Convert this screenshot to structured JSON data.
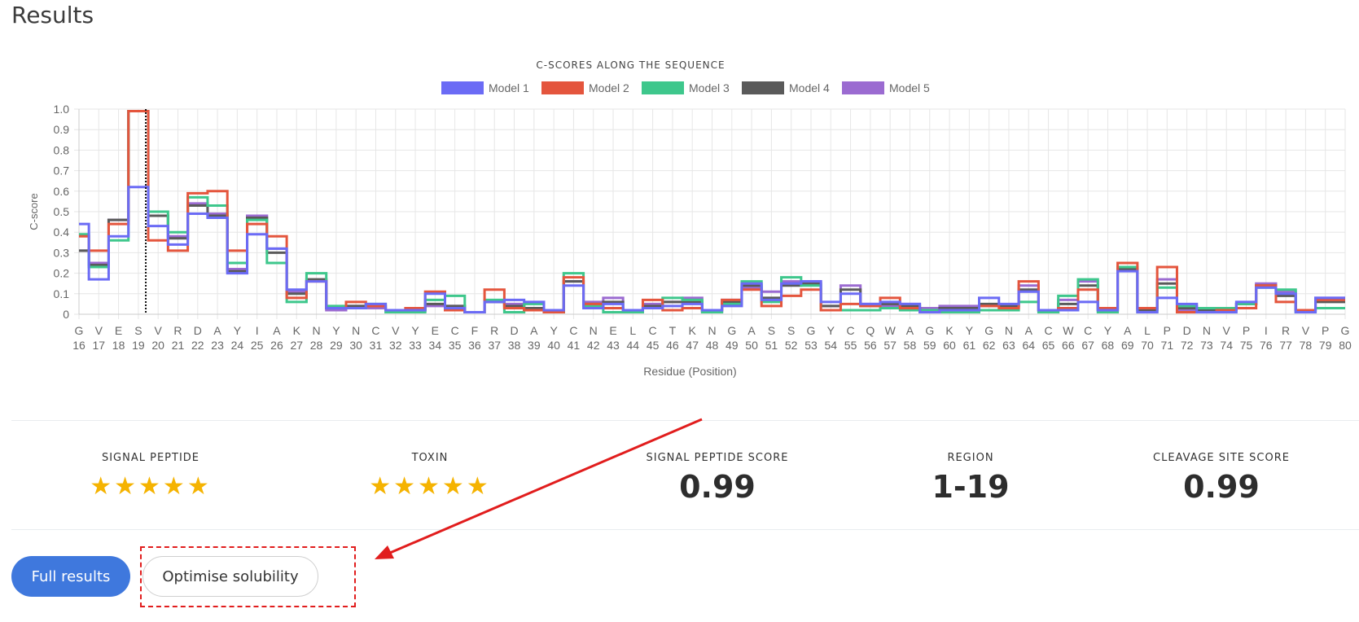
{
  "page": {
    "title": "Results"
  },
  "chart_data": {
    "type": "line",
    "title": "C-SCORES ALONG THE SEQUENCE",
    "xlabel": "Residue (Position)",
    "ylabel": "C-score",
    "ylim": [
      0,
      1.0
    ],
    "yticks": [
      "1.0",
      "0.9",
      "0.8",
      "0.7",
      "0.6",
      "0.5",
      "0.4",
      "0.3",
      "0.2",
      "0.1",
      "0"
    ],
    "grid": true,
    "legend_position": "top-center",
    "step": true,
    "highlight_position": 19,
    "residues": [
      "G",
      "V",
      "E",
      "S",
      "V",
      "R",
      "D",
      "A",
      "Y",
      "I",
      "A",
      "K",
      "N",
      "Y",
      "N",
      "C",
      "V",
      "Y",
      "E",
      "C",
      "F",
      "R",
      "D",
      "A",
      "Y",
      "C",
      "N",
      "E",
      "L",
      "C",
      "T",
      "K",
      "N",
      "G",
      "A",
      "S",
      "S",
      "G",
      "Y",
      "C",
      "Q",
      "W",
      "A",
      "G",
      "K",
      "Y",
      "G",
      "N",
      "A",
      "C",
      "W",
      "C",
      "Y",
      "A",
      "L",
      "P",
      "D",
      "N",
      "V",
      "P",
      "I",
      "R",
      "V",
      "P",
      "G"
    ],
    "positions": [
      "16",
      "17",
      "18",
      "19",
      "20",
      "21",
      "22",
      "23",
      "24",
      "25",
      "26",
      "27",
      "28",
      "29",
      "30",
      "31",
      "32",
      "33",
      "34",
      "35",
      "36",
      "37",
      "38",
      "39",
      "40",
      "41",
      "42",
      "43",
      "44",
      "45",
      "46",
      "47",
      "48",
      "49",
      "50",
      "51",
      "52",
      "53",
      "54",
      "55",
      "56",
      "57",
      "58",
      "59",
      "60",
      "61",
      "62",
      "63",
      "64",
      "65",
      "66",
      "67",
      "68",
      "69",
      "70",
      "71",
      "72",
      "73",
      "74",
      "75",
      "76",
      "77",
      "78",
      "79",
      "80"
    ],
    "series": [
      {
        "name": "Model 1",
        "color": "#6b6bf5",
        "values": [
          0.44,
          0.17,
          0.38,
          0.62,
          0.43,
          0.34,
          0.49,
          0.47,
          0.2,
          0.39,
          0.32,
          0.12,
          0.16,
          0.03,
          0.03,
          0.05,
          0.02,
          0.02,
          0.1,
          0.03,
          0.01,
          0.06,
          0.07,
          0.06,
          0.02,
          0.14,
          0.03,
          0.05,
          0.02,
          0.03,
          0.04,
          0.05,
          0.02,
          0.04,
          0.15,
          0.07,
          0.15,
          0.16,
          0.06,
          0.1,
          0.05,
          0.06,
          0.05,
          0.01,
          0.02,
          0.02,
          0.08,
          0.05,
          0.11,
          0.02,
          0.02,
          0.06,
          0.02,
          0.21,
          0.01,
          0.08,
          0.05,
          0.01,
          0.01,
          0.06,
          0.13,
          0.1,
          0.01,
          0.08,
          0.08
        ]
      },
      {
        "name": "Model 2",
        "color": "#e4553d",
        "values": [
          0.38,
          0.31,
          0.44,
          0.99,
          0.36,
          0.31,
          0.59,
          0.6,
          0.31,
          0.44,
          0.38,
          0.08,
          0.16,
          0.03,
          0.06,
          0.04,
          0.02,
          0.03,
          0.11,
          0.02,
          0.01,
          0.12,
          0.03,
          0.02,
          0.01,
          0.18,
          0.05,
          0.03,
          0.02,
          0.07,
          0.02,
          0.03,
          0.02,
          0.07,
          0.12,
          0.04,
          0.09,
          0.12,
          0.02,
          0.05,
          0.04,
          0.08,
          0.03,
          0.01,
          0.02,
          0.02,
          0.04,
          0.03,
          0.16,
          0.02,
          0.03,
          0.12,
          0.03,
          0.25,
          0.03,
          0.23,
          0.01,
          0.01,
          0.02,
          0.03,
          0.14,
          0.06,
          0.02,
          0.07,
          0.07
        ]
      },
      {
        "name": "Model 3",
        "color": "#3ec78c",
        "values": [
          0.39,
          0.23,
          0.36,
          0.99,
          0.5,
          0.4,
          0.57,
          0.53,
          0.25,
          0.46,
          0.25,
          0.06,
          0.2,
          0.04,
          0.03,
          0.05,
          0.01,
          0.01,
          0.07,
          0.09,
          0.01,
          0.07,
          0.01,
          0.05,
          0.01,
          0.2,
          0.04,
          0.01,
          0.01,
          0.03,
          0.08,
          0.07,
          0.01,
          0.05,
          0.16,
          0.06,
          0.18,
          0.14,
          0.02,
          0.02,
          0.02,
          0.03,
          0.02,
          0.02,
          0.01,
          0.01,
          0.02,
          0.02,
          0.06,
          0.01,
          0.09,
          0.17,
          0.01,
          0.23,
          0.01,
          0.13,
          0.04,
          0.03,
          0.03,
          0.05,
          0.13,
          0.12,
          0.01,
          0.03,
          0.03
        ]
      },
      {
        "name": "Model 4",
        "color": "#5a5a5a",
        "values": [
          0.31,
          0.24,
          0.46,
          0.99,
          0.48,
          0.37,
          0.53,
          0.48,
          0.21,
          0.47,
          0.3,
          0.1,
          0.17,
          0.03,
          0.04,
          0.04,
          0.02,
          0.02,
          0.05,
          0.04,
          0.01,
          0.06,
          0.04,
          0.03,
          0.01,
          0.16,
          0.05,
          0.06,
          0.02,
          0.04,
          0.06,
          0.06,
          0.02,
          0.06,
          0.14,
          0.08,
          0.14,
          0.15,
          0.04,
          0.12,
          0.04,
          0.05,
          0.04,
          0.02,
          0.03,
          0.03,
          0.05,
          0.04,
          0.12,
          0.02,
          0.05,
          0.14,
          0.02,
          0.22,
          0.02,
          0.15,
          0.03,
          0.02,
          0.02,
          0.05,
          0.14,
          0.09,
          0.02,
          0.06,
          0.06
        ]
      },
      {
        "name": "Model 5",
        "color": "#9b6bd1",
        "values": [
          0.31,
          0.25,
          0.46,
          0.99,
          0.48,
          0.38,
          0.54,
          0.49,
          0.22,
          0.48,
          0.32,
          0.11,
          0.16,
          0.02,
          0.04,
          0.03,
          0.02,
          0.02,
          0.04,
          0.04,
          0.01,
          0.06,
          0.05,
          0.02,
          0.01,
          0.16,
          0.06,
          0.08,
          0.02,
          0.05,
          0.06,
          0.08,
          0.01,
          0.07,
          0.13,
          0.11,
          0.16,
          0.16,
          0.04,
          0.14,
          0.05,
          0.04,
          0.05,
          0.03,
          0.04,
          0.04,
          0.04,
          0.04,
          0.14,
          0.02,
          0.07,
          0.16,
          0.03,
          0.22,
          0.03,
          0.17,
          0.02,
          0.02,
          0.02,
          0.05,
          0.15,
          0.11,
          0.02,
          0.08,
          0.08
        ]
      }
    ]
  },
  "stats": {
    "signal_peptide": {
      "label": "SIGNAL PEPTIDE",
      "stars": "★★★★★",
      "rating": 5
    },
    "toxin": {
      "label": "TOXIN",
      "stars": "★★★★★",
      "rating": 5
    },
    "signal_peptide_score": {
      "label": "SIGNAL PEPTIDE SCORE",
      "value": "0.99"
    },
    "region": {
      "label": "REGION",
      "value": "1-19"
    },
    "cleavage_site_score": {
      "label": "CLEAVAGE SITE SCORE",
      "value": "0.99"
    }
  },
  "actions": {
    "full_results": "Full results",
    "optimise_solubility": "Optimise solubility"
  },
  "annotation": {
    "arrow_color": "#e11d1d",
    "box_color": "#e11d1d"
  }
}
